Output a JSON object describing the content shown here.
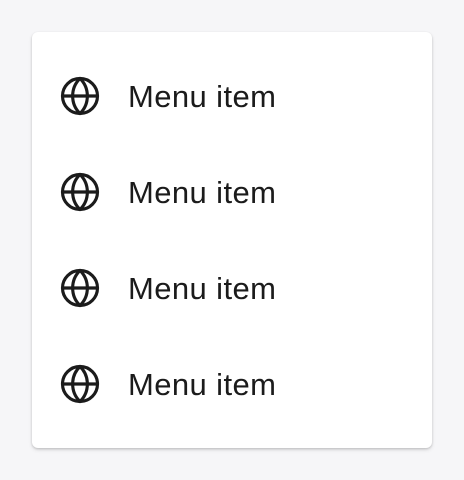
{
  "theme": {
    "background": "#f6f6f8",
    "surface": "#ffffff",
    "text": "#1b1b1b",
    "icon": "#1b1b1b"
  },
  "menu": {
    "items": [
      {
        "label": "Menu item",
        "icon": "globe-icon"
      },
      {
        "label": "Menu item",
        "icon": "globe-icon"
      },
      {
        "label": "Menu item",
        "icon": "globe-icon"
      },
      {
        "label": "Menu item",
        "icon": "globe-icon"
      }
    ]
  }
}
